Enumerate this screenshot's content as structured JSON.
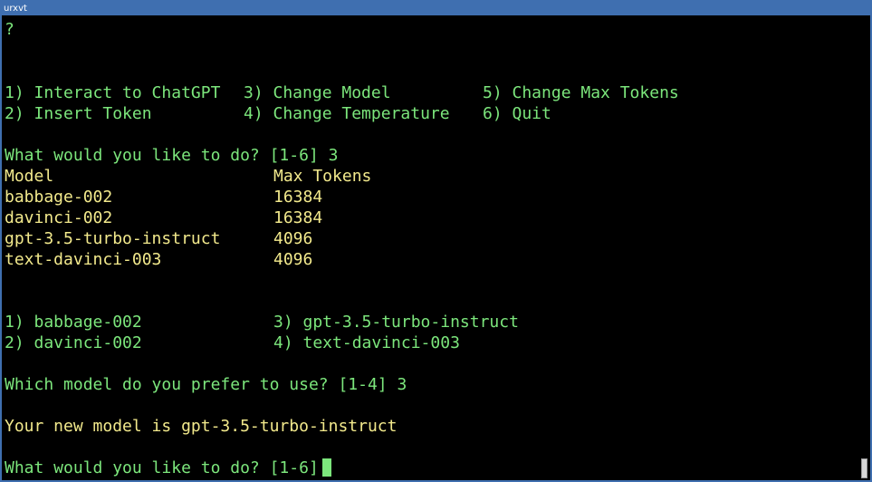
{
  "window": {
    "title": "urxvt"
  },
  "terminal": {
    "prompt_mark": "?",
    "menu": {
      "col1": [
        "1) Interact to ChatGPT",
        "2) Insert Token"
      ],
      "col2": [
        "3) Change Model",
        "4) Change Temperature"
      ],
      "col3": [
        "5) Change Max Tokens",
        "6) Quit"
      ]
    },
    "first_prompt": "What would you like to do? [1-6] 3",
    "model_table": {
      "headers": [
        "Model",
        "Max Tokens"
      ],
      "rows": [
        [
          "babbage-002",
          "16384"
        ],
        [
          "davinci-002",
          "16384"
        ],
        [
          "gpt-3.5-turbo-instruct",
          "4096"
        ],
        [
          "text-davinci-003",
          "4096"
        ]
      ]
    },
    "model_choices": {
      "col1": [
        "1) babbage-002",
        "2) davinci-002"
      ],
      "col2": [
        "3) gpt-3.5-turbo-instruct",
        "4) text-davinci-003"
      ]
    },
    "model_prompt": "Which model do you prefer to use? [1-4] 3",
    "result": "Your new model is gpt-3.5-turbo-instruct",
    "current_prompt": "What would you like to do? [1-6]"
  },
  "colors": {
    "prompt_text": "#7ce67c",
    "output_text": "#f2e98c",
    "background": "#000000",
    "titlebar": "#3f6fb0"
  }
}
